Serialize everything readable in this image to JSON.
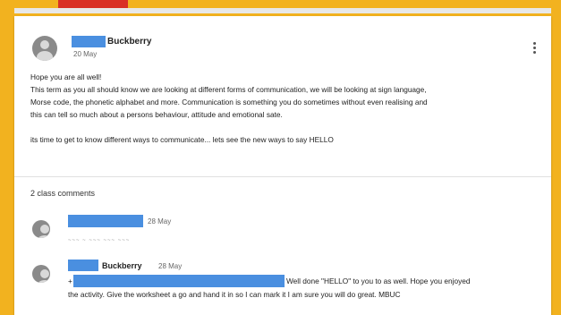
{
  "post": {
    "author_name": "Buckberry",
    "date": "20 May",
    "lines": [
      "Hope you are all well!",
      "This term as you all should know we are looking at different forms of communication, we will be looking at sign language,",
      "Morse code, the phonetic alphabet and more. Communication is something you do sometimes without even realising and",
      "this can tell so much about a persons behaviour, attitude and emotional sate.",
      "",
      "its time to get to know different ways to communicate... lets see the new ways to say HELLO"
    ]
  },
  "comments": {
    "count_label": "2 class comments",
    "items": [
      {
        "date": "28 May",
        "text": "~~~ ~ ~~~ ~~~ ~~~"
      },
      {
        "author_name": "Buckberry",
        "date": "28 May",
        "prefix": "+",
        "line1": "Well done \"HELLO\" to you to as well. Hope you enjoyed",
        "line2": "the activity. Give the worksheet a go and hand it in so I can mark it I am sure you will do great. MBUC"
      }
    ]
  },
  "colors": {
    "background": "#f2b21f",
    "redaction": "#4a8fe0",
    "accent_tab": "#d93025"
  }
}
